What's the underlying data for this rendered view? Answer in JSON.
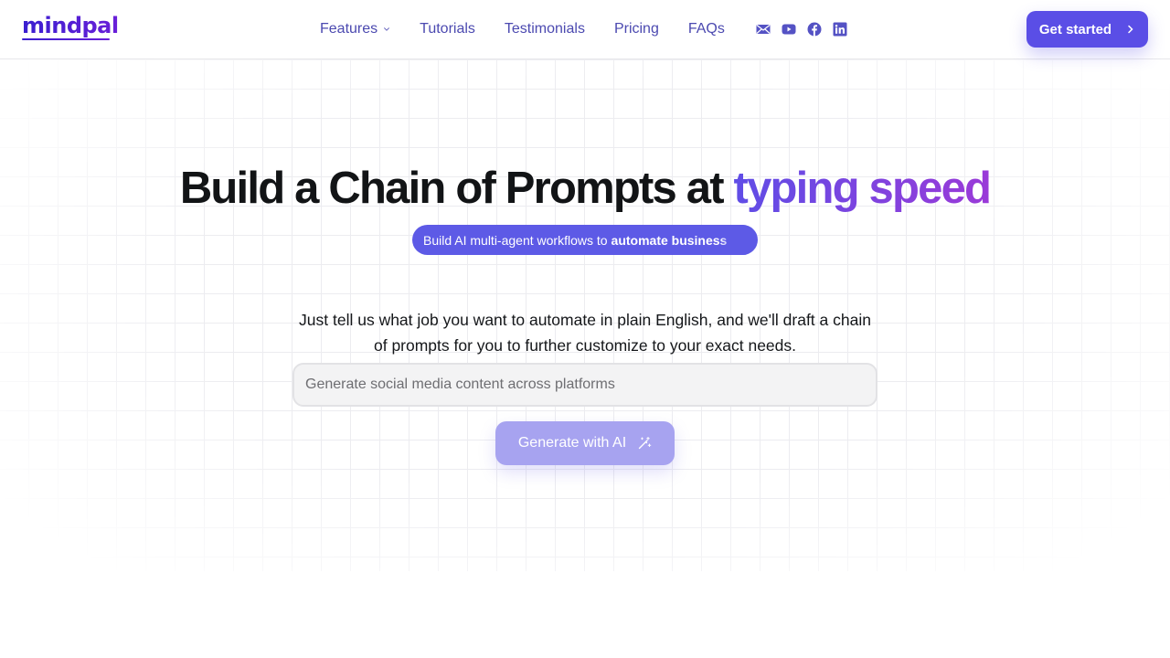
{
  "header": {
    "logo": "mindpal",
    "nav": [
      {
        "label": "Features",
        "has_dropdown": true
      },
      {
        "label": "Tutorials"
      },
      {
        "label": "Testimonials"
      },
      {
        "label": "Pricing"
      },
      {
        "label": "FAQs"
      }
    ],
    "socials": [
      "mail-icon",
      "youtube-icon",
      "facebook-icon",
      "linkedin-icon"
    ],
    "cta_label": "Get started"
  },
  "hero": {
    "title_main": "Build a Chain of Prompts at ",
    "title_accent": "typing speed",
    "pill_text": "Build AI multi-agent workflows to",
    "pill_bold": "automate business",
    "description": "Just tell us what job you want to automate in plain English, and we'll draft a chain of prompts for you to further customize to your exact needs.",
    "input_placeholder": "Generate social media content across platforms",
    "input_value": "",
    "generate_label": "Generate with AI"
  },
  "colors": {
    "brand": "#5a4ee6",
    "nav_text": "#4b49b0",
    "accent_gradient_start": "#5f4de6",
    "accent_gradient_end": "#9a3ad8",
    "generate_button": "#a7a3f0"
  }
}
